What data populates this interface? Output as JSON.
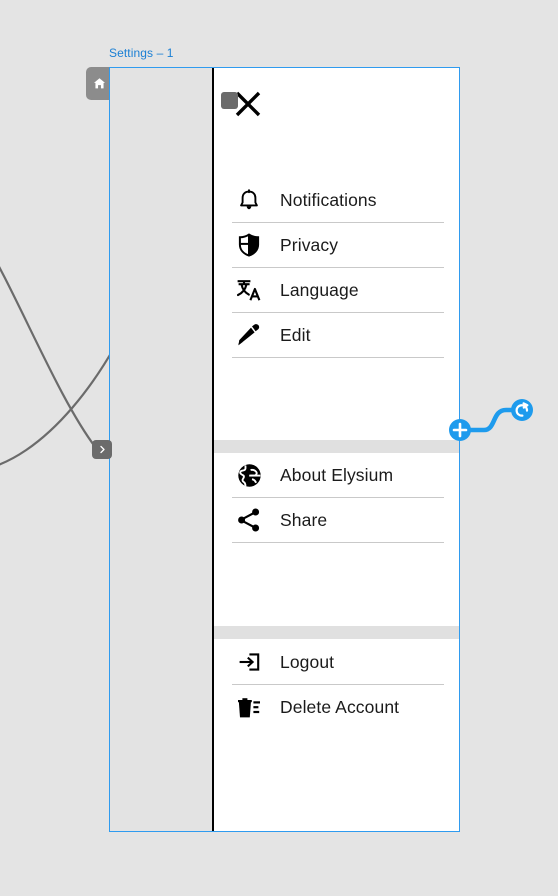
{
  "canvas": {
    "background_color": "#e4e4e4",
    "frame_label": "Settings – 1",
    "frame_accent_color": "#2f9bef",
    "home_tab_icon": "home-icon"
  },
  "artboard": {
    "panel_background": "#ffffff",
    "gutter_background": "#e3e3e3",
    "close_icon": "close-x-icon"
  },
  "menu": {
    "groups": [
      {
        "items": [
          {
            "icon": "bell-icon",
            "label": "Notifications"
          },
          {
            "icon": "shield-icon",
            "label": "Privacy"
          },
          {
            "icon": "translate-icon",
            "label": "Language"
          },
          {
            "icon": "pencil-icon",
            "label": "Edit"
          }
        ]
      },
      {
        "items": [
          {
            "icon": "globe-icon",
            "label": "About Elysium"
          },
          {
            "icon": "share-icon",
            "label": "Share"
          }
        ]
      },
      {
        "items": [
          {
            "icon": "logout-icon",
            "label": "Logout"
          },
          {
            "icon": "trash-icon",
            "label": "Delete Account"
          }
        ]
      }
    ]
  },
  "connector": {
    "accent_color": "#1e9bed",
    "start_icon": "plus-circle-icon",
    "end_icon": "reset-arrow-circle-icon"
  },
  "handles": {
    "left_handle_icon": "chevron-right-icon",
    "top_endpoint_icon": "connection-endpoint"
  }
}
